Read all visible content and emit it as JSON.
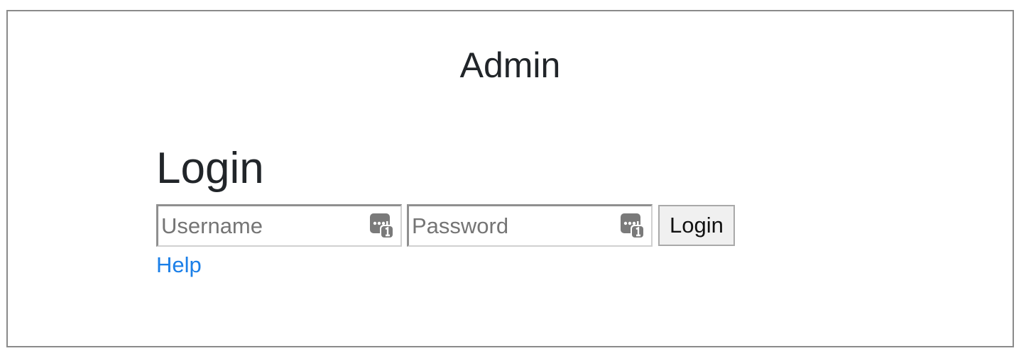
{
  "header": {
    "title": "Admin"
  },
  "login": {
    "heading": "Login",
    "username": {
      "value": "",
      "placeholder": "Username",
      "icon": "password-manager-icon"
    },
    "password": {
      "value": "",
      "placeholder": "Password",
      "icon": "password-manager-icon"
    },
    "submit_label": "Login",
    "help_label": "Help"
  },
  "colors": {
    "link": "#1a7fe8",
    "text": "#212529",
    "frame_border": "#8a8a8a",
    "button_bg": "#f0f0f0",
    "placeholder": "#757575",
    "icon": "#7a7a7a"
  }
}
